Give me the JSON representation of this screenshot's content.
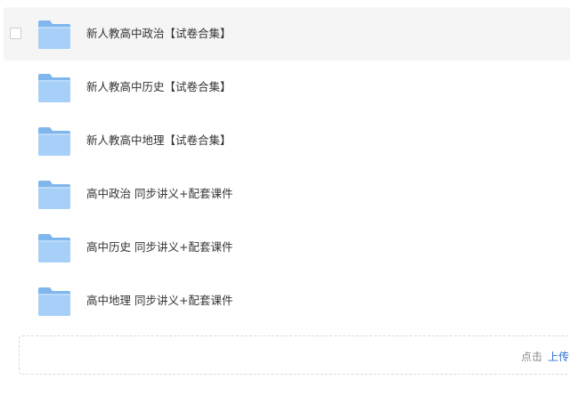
{
  "files": [
    {
      "name": "新人教高中政治【试卷合集】",
      "type": "folder",
      "hovered": true
    },
    {
      "name": "新人教高中历史【试卷合集】",
      "type": "folder"
    },
    {
      "name": "新人教高中地理【试卷合集】",
      "type": "folder"
    },
    {
      "name": "高中政治 同步讲义+配套课件",
      "type": "folder"
    },
    {
      "name": "高中历史 同步讲义+配套课件",
      "type": "folder"
    },
    {
      "name": "高中地理 同步讲义+配套课件",
      "type": "folder"
    }
  ],
  "upload": {
    "prompt": "点击",
    "link": "上传"
  },
  "colors": {
    "folder_back": "#7fb6ec",
    "folder_front": "#a7d0f8",
    "hover_bg": "#f5f5f6",
    "link": "#2e6fd0"
  }
}
